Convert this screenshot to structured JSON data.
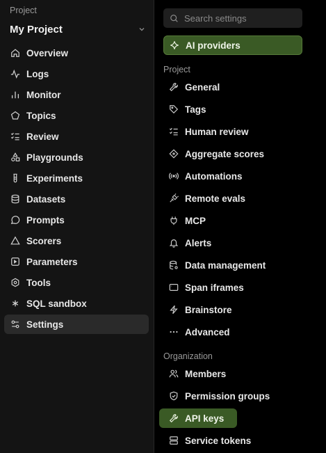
{
  "sidebar": {
    "project_label": "Project",
    "project_name": "My Project",
    "items": [
      {
        "label": "Overview",
        "icon": "home-icon"
      },
      {
        "label": "Logs",
        "icon": "activity-icon"
      },
      {
        "label": "Monitor",
        "icon": "bar-chart-icon"
      },
      {
        "label": "Topics",
        "icon": "pentagon-icon"
      },
      {
        "label": "Review",
        "icon": "list-check-icon"
      },
      {
        "label": "Playgrounds",
        "icon": "shapes-icon"
      },
      {
        "label": "Experiments",
        "icon": "beaker-icon"
      },
      {
        "label": "Datasets",
        "icon": "database-icon"
      },
      {
        "label": "Prompts",
        "icon": "message-icon"
      },
      {
        "label": "Scorers",
        "icon": "triangle-icon"
      },
      {
        "label": "Parameters",
        "icon": "square-dot-icon"
      },
      {
        "label": "Tools",
        "icon": "hexagon-icon"
      },
      {
        "label": "SQL sandbox",
        "icon": "asterisk-icon"
      },
      {
        "label": "Settings",
        "icon": "settings-sliders-icon",
        "active": true
      }
    ]
  },
  "settings": {
    "search_placeholder": "Search settings",
    "ai_providers": "AI providers",
    "project_section": "Project",
    "project_items": [
      {
        "label": "General",
        "icon": "wrench-icon"
      },
      {
        "label": "Tags",
        "icon": "tag-icon"
      },
      {
        "label": "Human review",
        "icon": "list-check-icon"
      },
      {
        "label": "Aggregate scores",
        "icon": "diamond-icon"
      },
      {
        "label": "Automations",
        "icon": "broadcast-icon"
      },
      {
        "label": "Remote evals",
        "icon": "plug-link-icon"
      },
      {
        "label": "MCP",
        "icon": "plug-icon"
      },
      {
        "label": "Alerts",
        "icon": "bell-icon"
      },
      {
        "label": "Data management",
        "icon": "database-gear-icon"
      },
      {
        "label": "Span iframes",
        "icon": "window-icon"
      },
      {
        "label": "Brainstore",
        "icon": "bolt-icon"
      },
      {
        "label": "Advanced",
        "icon": "ellipsis-icon"
      }
    ],
    "org_section": "Organization",
    "org_items": [
      {
        "label": "Members",
        "icon": "users-icon"
      },
      {
        "label": "Permission groups",
        "icon": "shield-icon"
      },
      {
        "label": "API keys",
        "icon": "key-icon",
        "highlighted": true
      },
      {
        "label": "Service tokens",
        "icon": "server-icon"
      }
    ]
  },
  "colors": {
    "accent_green": "#3a5a25",
    "sidebar_bg": "#141414",
    "panel_bg": "#000000"
  }
}
